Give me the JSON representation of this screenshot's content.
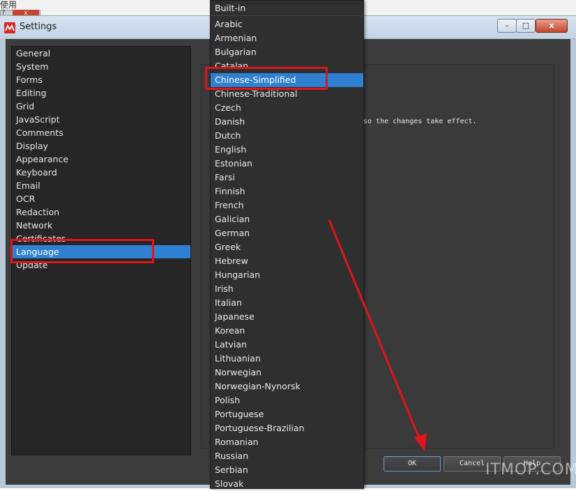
{
  "background_window": {
    "text": "使用",
    "help_glyph": "?",
    "close_glyph": "x"
  },
  "window": {
    "title": "Settings",
    "controls": {
      "minimize": "–",
      "maximize": "□",
      "close": "x"
    }
  },
  "categories": [
    {
      "label": "General"
    },
    {
      "label": "System"
    },
    {
      "label": "Forms"
    },
    {
      "label": "Editing"
    },
    {
      "label": "Grid"
    },
    {
      "label": "JavaScript"
    },
    {
      "label": "Comments"
    },
    {
      "label": "Display"
    },
    {
      "label": "Appearance"
    },
    {
      "label": "Keyboard"
    },
    {
      "label": "Email"
    },
    {
      "label": "OCR"
    },
    {
      "label": "Redaction"
    },
    {
      "label": "Network"
    },
    {
      "label": "Certificates"
    },
    {
      "label": "Language"
    },
    {
      "label": "Update"
    }
  ],
  "selected_category": "Language",
  "language_panel": {
    "restart_note": "so the changes take effect."
  },
  "language_dropdown": {
    "header": "Built-in",
    "selected": "Chinese-Simplified",
    "options": [
      "Arabic",
      "Armenian",
      "Bulgarian",
      "Catalan",
      "Chinese-Simplified",
      "Chinese-Traditional",
      "Czech",
      "Danish",
      "Dutch",
      "English",
      "Estonian",
      "Farsi",
      "Finnish",
      "French",
      "Galician",
      "German",
      "Greek",
      "Hebrew",
      "Hungarian",
      "Irish",
      "Italian",
      "Japanese",
      "Korean",
      "Latvian",
      "Lithuanian",
      "Norwegian",
      "Norwegian-Nynorsk",
      "Polish",
      "Portuguese",
      "Portuguese-Brazilian",
      "Romanian",
      "Russian",
      "Serbian",
      "Slovak"
    ]
  },
  "buttons": {
    "ok": "OK",
    "cancel": "Cancel",
    "help": "Help"
  },
  "watermark": "ITMOP.COM",
  "colors": {
    "selection": "#2f80d0",
    "annotation": "#e0141b",
    "app_icon": "#d9271f"
  }
}
